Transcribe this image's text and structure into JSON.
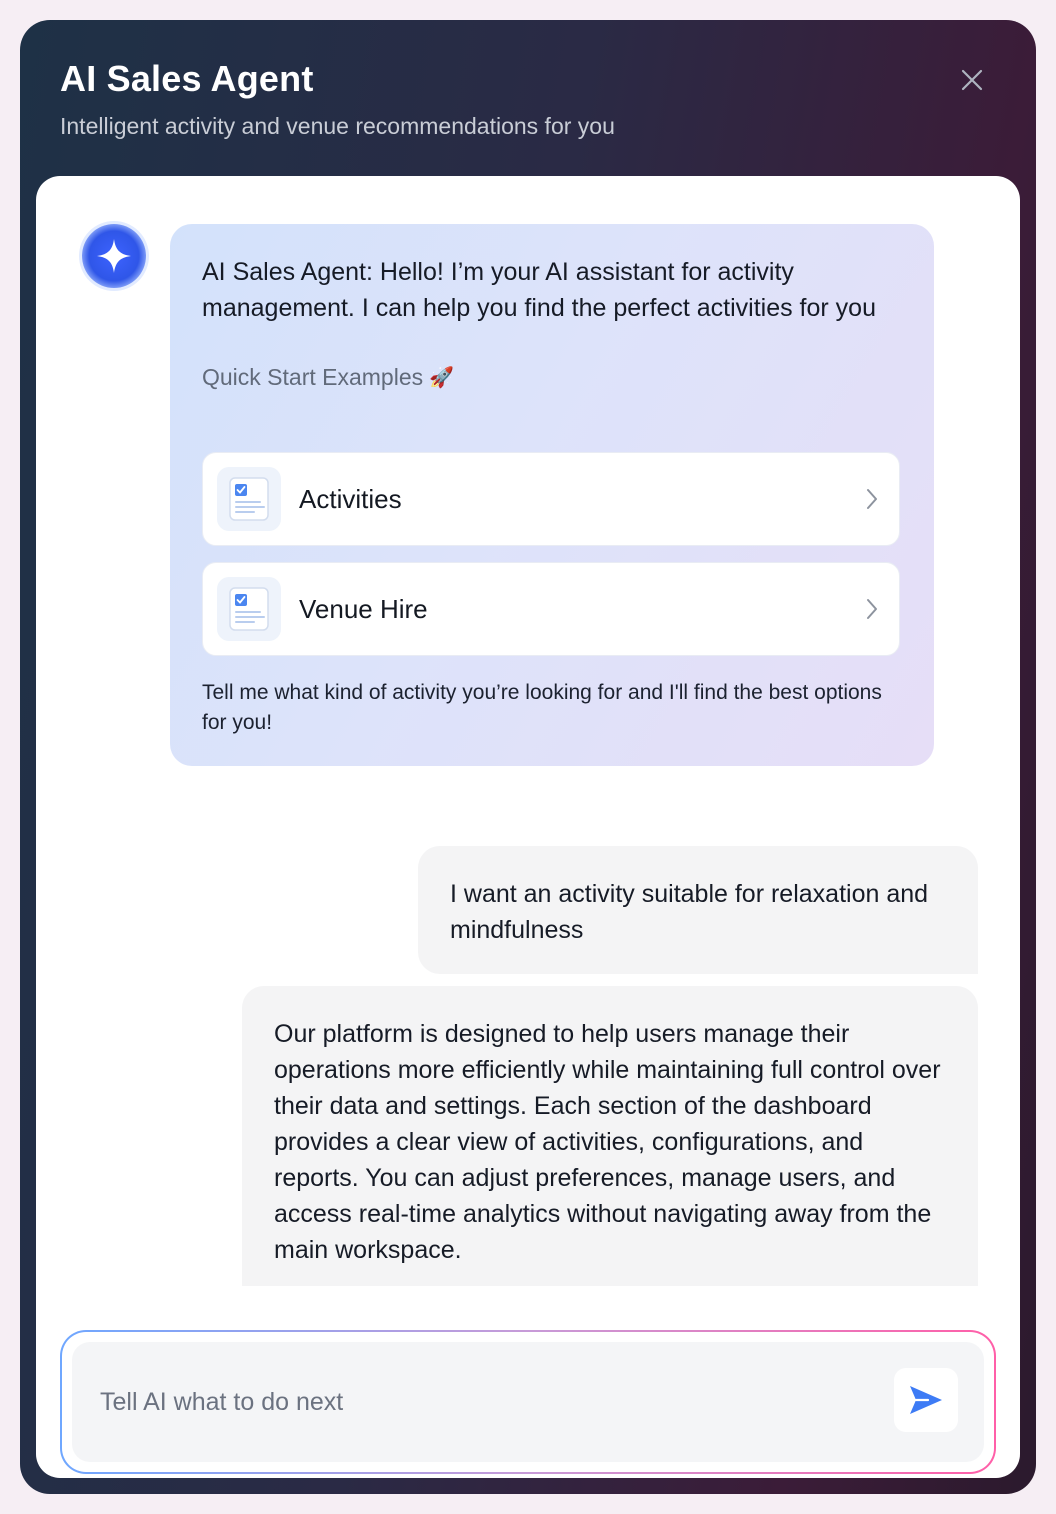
{
  "header": {
    "title": "AI Sales Agent",
    "subtitle": "Intelligent activity and venue recommendations for you"
  },
  "bot_message": {
    "greeting": "AI Sales Agent: Hello! I’m your AI assistant for activity management. I can help you find the perfect activities for you",
    "quick_start_title": "Quick Start Examples",
    "quick_start_emoji": "🚀",
    "quick_starts": [
      {
        "label": "Activities"
      },
      {
        "label": "Venue Hire"
      }
    ],
    "footer": "Tell me what kind of activity you’re looking for and I'll find the best options for you!"
  },
  "user_message": "I want an activity suitable for relaxation and mindfulness",
  "reply_message": "Our platform is designed to help users manage their operations more efficiently while maintaining full control over their data and settings. Each section of the dashboard provides a clear view of activities, configurations, and reports. You can adjust preferences, manage users, and access real-time analytics without navigating away from the main workspace.",
  "composer": {
    "placeholder": "Tell AI what to do next"
  },
  "colors": {
    "accent_blue": "#3d7bf5",
    "header_bg_start": "#1e3146",
    "header_bg_end": "#3b1c38"
  }
}
